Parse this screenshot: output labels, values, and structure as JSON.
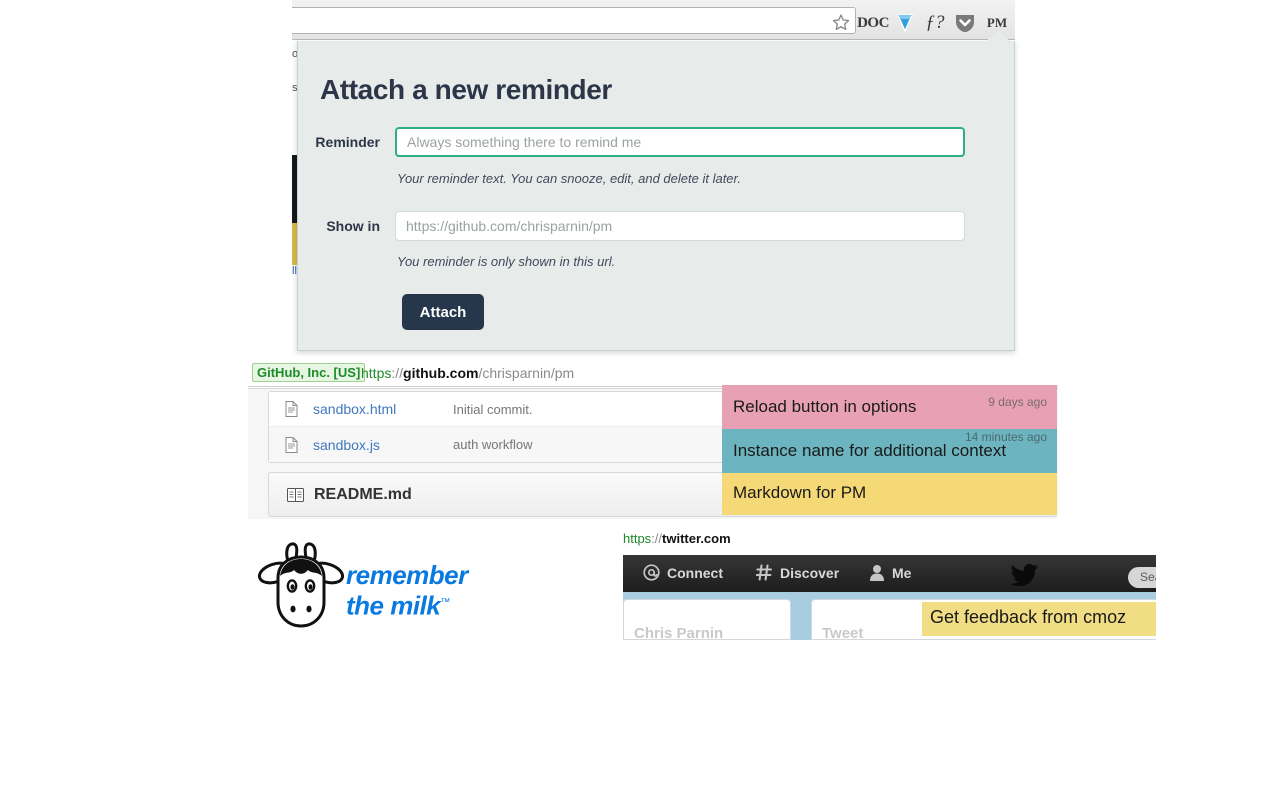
{
  "browser_toolbar": {
    "url_value": "",
    "url_placeholder": "",
    "icons": [
      {
        "name": "bookmark-star-icon",
        "label": ""
      },
      {
        "name": "doc-extension-icon",
        "label": "DOC"
      },
      {
        "name": "gem-extension-icon",
        "label": ""
      },
      {
        "name": "f-question-extension-icon",
        "label": "ƒ?"
      },
      {
        "name": "pocket-extension-icon",
        "label": ""
      },
      {
        "name": "pm-extension-icon",
        "label": "PM"
      }
    ]
  },
  "popup": {
    "title": "Attach a new reminder",
    "reminder": {
      "label": "Reminder",
      "value": "",
      "placeholder": "Always something there to remind me",
      "help": "Your reminder text. You can snooze, edit, and delete it later."
    },
    "show_in": {
      "label": "Show in",
      "value": "",
      "placeholder": "https://github.com/chrisparnin/pm",
      "help": "You reminder is only shown in this url."
    },
    "attach_label": "Attach",
    "background_color": "#e7ecea",
    "accent_focus_color": "#2fae86",
    "button_color": "#27374b"
  },
  "behind_page": {
    "text_top": "o",
    "text_second": "s",
    "text_bottom": "ll"
  },
  "github_window": {
    "ev_badge": "GitHub, Inc. [US]",
    "url": {
      "scheme": "https",
      "separator": "://",
      "domain": "github.com",
      "path": "/chrisparnin/pm"
    },
    "files": [
      {
        "icon": "file-text-icon",
        "name": "sandbox.html",
        "message": "Initial commit."
      },
      {
        "icon": "file-text-icon",
        "name": "sandbox.js",
        "message": "auth workflow"
      }
    ],
    "readme": {
      "icon": "book-icon",
      "name": "README.md"
    }
  },
  "sticky_notes": [
    {
      "text": "Reload button in options",
      "time": "9 days ago",
      "color": "#e8a0b4"
    },
    {
      "text": "Instance name for additional context",
      "time": "14 minutes ago",
      "color": "#6cb4bf"
    },
    {
      "text": "Markdown for PM",
      "time": "",
      "color": "#f5d976"
    }
  ],
  "rtm_logo": {
    "line1": "remember",
    "line2": "the milk",
    "trademark": "™",
    "color": "#0a7ae0",
    "icon": "cow-head-icon"
  },
  "twitter_window": {
    "url": {
      "scheme": "https",
      "separator": "://",
      "domain": "twitter.com"
    },
    "nav_items": [
      {
        "icon": "at-icon",
        "label": "Connect"
      },
      {
        "icon": "hash-icon",
        "label": "Discover"
      },
      {
        "icon": "person-icon",
        "label": "Me"
      }
    ],
    "bird_icon": "twitter-bird-icon",
    "search_placeholder": "Search",
    "card_left_text": "Chris Parnin",
    "card_right_text": "Tweet",
    "sticky": {
      "text": "Get feedback from cmoz",
      "color": "#f0dd84"
    }
  }
}
